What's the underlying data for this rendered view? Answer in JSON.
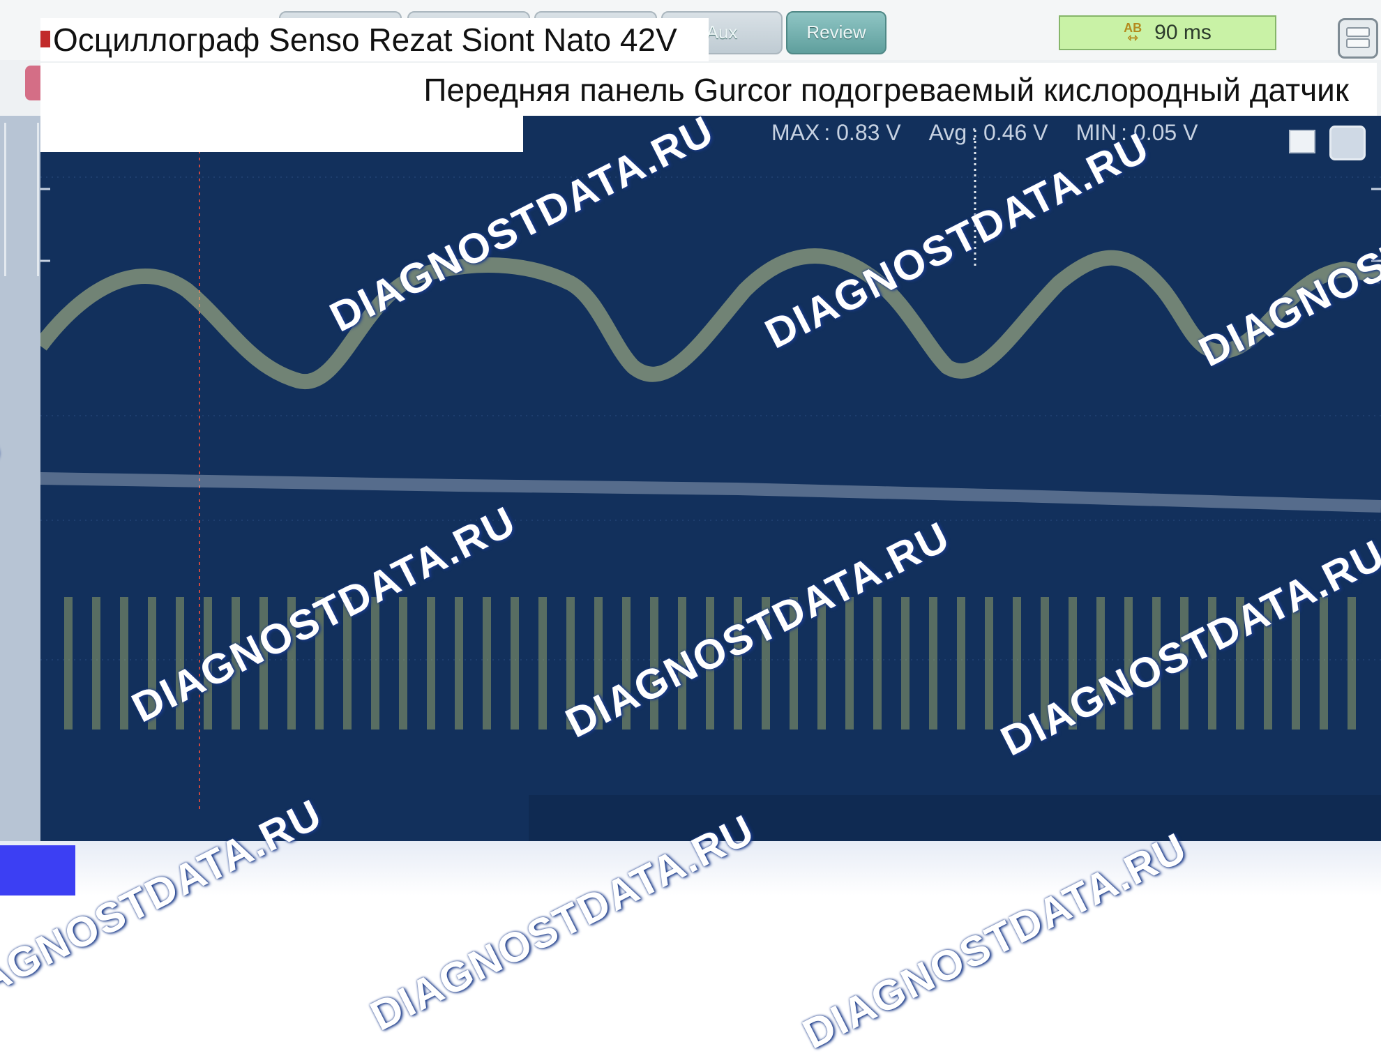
{
  "window": {
    "title": "Осциллограф Senso Rezat Siont Nato 42V",
    "subtitle": "Передняя панель Gurcor подогреваемый кислородный датчик"
  },
  "toolbar": {
    "review_label": "Review",
    "aux_label": "Aux",
    "timebase_icon": "AB",
    "timebase_value": "90 ms"
  },
  "measurements": [
    {
      "label": "MAX",
      "value": ": 0.83 V"
    },
    {
      "label": "Avg",
      "value": ": 0.46 V"
    },
    {
      "label": "MIN",
      "value": ": 0.05 V"
    }
  ],
  "watermark": {
    "text": "DIAGNOSTDATA.RU"
  },
  "colors": {
    "scope_background": "#12305c",
    "trace": "#bfc88a",
    "review_button": "#6fa9a7",
    "timebase_bg": "#c9f2a6"
  }
}
